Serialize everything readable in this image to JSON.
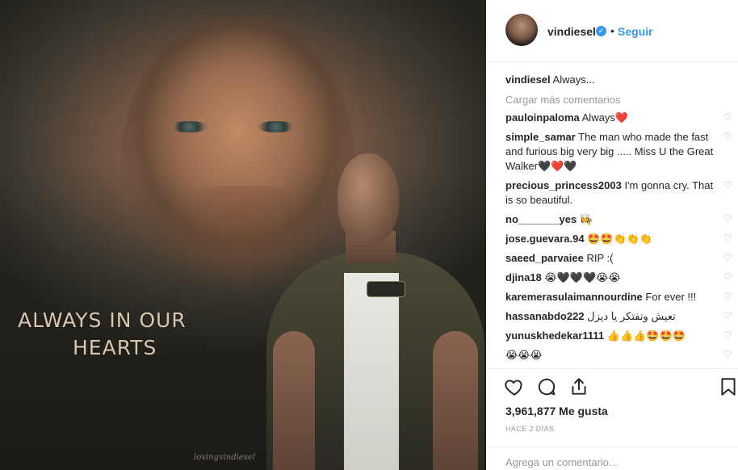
{
  "post": {
    "username": "vindiesel",
    "verified_badge": "✓",
    "separator": "•",
    "follow_label": "Seguir",
    "image_caption_line1": "ALWAYS IN OUR",
    "image_caption_line2": "HEARTS",
    "image_watermark": "lovingvindiesel",
    "caption_user": "vindiesel",
    "caption_text": "Always...",
    "load_more_label": "Cargar más comentarios"
  },
  "comments": [
    {
      "user": "pauloinpaloma",
      "text": "Always❤️"
    },
    {
      "user": "simple_samar",
      "text": "The man who made the fast and furious big very big ..... Miss U the Great Walker🖤❤️🖤"
    },
    {
      "user": "precious_princess2003",
      "text": "I'm gonna cry. That is so beautiful."
    },
    {
      "user": "no_______yes",
      "text": "👩‍🍳"
    },
    {
      "user": "jose.guevara.94",
      "text": "🤩🤩👏👏👏"
    },
    {
      "user": "saeed_parvaiee",
      "text": "RIP :("
    },
    {
      "user": "djina18",
      "text": "😭🖤🖤🖤😭😭"
    },
    {
      "user": "karemerasulaimannourdine",
      "text": "For ever !!!"
    },
    {
      "user": "hassanabdo222",
      "text": "تعيش وتفتكر يا ديزل"
    },
    {
      "user": "yunuskhedekar1111",
      "text": "👍👍👍🤩🤩🤩"
    },
    {
      "user": "",
      "text": "😭😭😭"
    }
  ],
  "actions": {
    "like_icon": "heart-outline-icon",
    "comment_icon": "speech-bubble-icon",
    "share_icon": "share-upload-icon",
    "save_icon": "bookmark-icon",
    "likes_count": "3,961,877 Me gusta",
    "time_ago": "HACE 2 DÍAS"
  },
  "add_comment": {
    "placeholder": "Agrega un comentario..."
  },
  "colors": {
    "accent": "#3897f0",
    "muted": "#999999",
    "text": "#262626",
    "border": "#efefef",
    "heart_red": "#ed4956"
  }
}
